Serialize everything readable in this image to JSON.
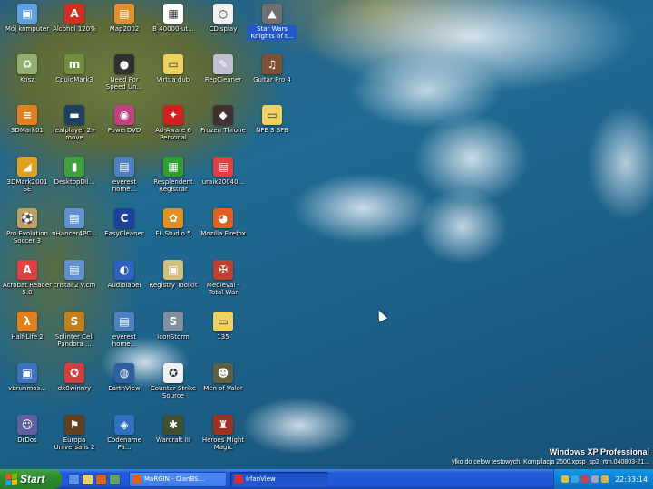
{
  "icons": [
    {
      "name": "moj-komputer",
      "label": "Mój komputer",
      "col": 0,
      "row": 0,
      "color": "#5fa0e0",
      "glyph": "▣"
    },
    {
      "name": "alcohol-120",
      "label": "Alcohol 120%",
      "col": 1,
      "row": 0,
      "color": "#d03020",
      "glyph": "A"
    },
    {
      "name": "map2002",
      "label": "Map2002",
      "col": 2,
      "row": 0,
      "color": "#e09030",
      "glyph": "▤"
    },
    {
      "name": "b-40000",
      "label": "B 40000-ut...",
      "col": 3,
      "row": 0,
      "color": "#ffffff",
      "glyph": "▦"
    },
    {
      "name": "cdisplay",
      "label": "CDisplay",
      "col": 4,
      "row": 0,
      "color": "#f0f0f0",
      "glyph": "○"
    },
    {
      "name": "star-wars",
      "label": "Star Wars Knights of t...",
      "col": 5,
      "row": 0,
      "color": "#707070",
      "glyph": "▲",
      "sel": true
    },
    {
      "name": "kosz",
      "label": "Kosz",
      "col": 0,
      "row": 1,
      "color": "#8fb06f",
      "glyph": "♻"
    },
    {
      "name": "cpuid-mark",
      "label": "CpuidMark3",
      "col": 1,
      "row": 1,
      "color": "#6f8f3f",
      "glyph": "m"
    },
    {
      "name": "need-for-speed",
      "label": "Need For Speed Un...",
      "col": 2,
      "row": 1,
      "color": "#303030",
      "glyph": "●"
    },
    {
      "name": "virtua-dub",
      "label": "Virtua dub",
      "col": 3,
      "row": 1,
      "color": "#f0d060",
      "glyph": "▭"
    },
    {
      "name": "regcleaner",
      "label": "RegCleaner",
      "col": 4,
      "row": 1,
      "color": "#c0c0d0",
      "glyph": "✎"
    },
    {
      "name": "guitar-pro",
      "label": "Guitar Pro 4",
      "col": 5,
      "row": 1,
      "color": "#805030",
      "glyph": "♫"
    },
    {
      "name": "3dmark01",
      "label": "3DMark01",
      "col": 0,
      "row": 2,
      "color": "#e08020",
      "glyph": "≡"
    },
    {
      "name": "realplayer",
      "label": "realplayer 2+ move",
      "col": 1,
      "row": 2,
      "color": "#204060",
      "glyph": "▬"
    },
    {
      "name": "powerdvd",
      "label": "PowerDVD",
      "col": 2,
      "row": 2,
      "color": "#c04080",
      "glyph": "◉"
    },
    {
      "name": "ad-aware",
      "label": "Ad-Aware 6 Personal",
      "col": 3,
      "row": 2,
      "color": "#d02020",
      "glyph": "✦"
    },
    {
      "name": "frozen-throne",
      "label": "Frozen Throne",
      "col": 4,
      "row": 2,
      "color": "#403030",
      "glyph": "◆"
    },
    {
      "name": "nfe-sfb",
      "label": "NFE 3 SFB",
      "col": 5,
      "row": 2,
      "color": "#f0d060",
      "glyph": "▭"
    },
    {
      "name": "3dmark2001",
      "label": "3DMark2001 SE",
      "col": 0,
      "row": 3,
      "color": "#e0a020",
      "glyph": "◢"
    },
    {
      "name": "desktop-dll",
      "label": "DesktopDll...",
      "col": 1,
      "row": 3,
      "color": "#40a040",
      "glyph": "▮"
    },
    {
      "name": "everest-home-1",
      "label": "everest home...",
      "col": 2,
      "row": 3,
      "color": "#5080c0",
      "glyph": "▤"
    },
    {
      "name": "resplendent-registrar",
      "label": "Resplendent Registrar",
      "col": 3,
      "row": 3,
      "color": "#30a030",
      "glyph": "▦"
    },
    {
      "name": "uraik-pdf",
      "label": "uraik20040...",
      "col": 4,
      "row": 3,
      "color": "#e04040",
      "glyph": "▤"
    },
    {
      "name": "pro-evolution",
      "label": "Pro Evolution Soccer 3",
      "col": 0,
      "row": 4,
      "color": "#c0a060",
      "glyph": "⚽"
    },
    {
      "name": "nhancer",
      "label": "nHancer4PC...",
      "col": 1,
      "row": 4,
      "color": "#6090d0",
      "glyph": "▤"
    },
    {
      "name": "easycleaner",
      "label": "EasyCleaner",
      "col": 2,
      "row": 4,
      "color": "#2040a0",
      "glyph": "C"
    },
    {
      "name": "fl-studio",
      "label": "FL Studio 5",
      "col": 3,
      "row": 4,
      "color": "#e09020",
      "glyph": "✿"
    },
    {
      "name": "mozilla-firefox",
      "label": "Mozilla Firefox",
      "col": 4,
      "row": 4,
      "color": "#e06020",
      "glyph": "◕"
    },
    {
      "name": "acrobat-reader",
      "label": "Acrobat Reader 5.0",
      "col": 0,
      "row": 5,
      "color": "#e04040",
      "glyph": "A"
    },
    {
      "name": "cristal-2",
      "label": "cristal 2 v.cm",
      "col": 1,
      "row": 5,
      "color": "#6090d0",
      "glyph": "▤"
    },
    {
      "name": "audiolabel",
      "label": "Audiolabel",
      "col": 2,
      "row": 5,
      "color": "#3060c0",
      "glyph": "◐"
    },
    {
      "name": "registry-toolkit",
      "label": "Registry Toolkit",
      "col": 3,
      "row": 5,
      "color": "#d0c080",
      "glyph": "▣"
    },
    {
      "name": "medieval",
      "label": "Medieval - Total War",
      "col": 4,
      "row": 5,
      "color": "#c04030",
      "glyph": "✠"
    },
    {
      "name": "half-life-2",
      "label": "Half-Life 2",
      "col": 0,
      "row": 6,
      "color": "#e08020",
      "glyph": "λ"
    },
    {
      "name": "splinter-cell",
      "label": "Splinter Cell Pandora ...",
      "col": 1,
      "row": 6,
      "color": "#c08020",
      "glyph": "S"
    },
    {
      "name": "everest-home-2",
      "label": "everest home...",
      "col": 2,
      "row": 6,
      "color": "#5080c0",
      "glyph": "▤"
    },
    {
      "name": "iconstorm",
      "label": "IconStorm",
      "col": 3,
      "row": 6,
      "color": "#8090a0",
      "glyph": "S"
    },
    {
      "name": "folder-135",
      "label": "135",
      "col": 4,
      "row": 6,
      "color": "#f0d060",
      "glyph": "▭"
    },
    {
      "name": "vbrunmos",
      "label": "vbrunmos...",
      "col": 0,
      "row": 7,
      "color": "#4070c0",
      "glyph": "▣"
    },
    {
      "name": "dx8-win",
      "label": "dx8winnry",
      "col": 1,
      "row": 7,
      "color": "#d04040",
      "glyph": "✪"
    },
    {
      "name": "earthview",
      "label": "EarthView",
      "col": 2,
      "row": 7,
      "color": "#3060a0",
      "glyph": "◍"
    },
    {
      "name": "counter-strike",
      "label": "Counter Strike Source",
      "col": 3,
      "row": 7,
      "color": "#f0f0f0",
      "glyph": "✪"
    },
    {
      "name": "men-of-valor",
      "label": "Men of Valor",
      "col": 4,
      "row": 7,
      "color": "#606040",
      "glyph": "☻"
    },
    {
      "name": "drdos",
      "label": "DrDos",
      "col": 0,
      "row": 8,
      "color": "#6060a0",
      "glyph": "☺"
    },
    {
      "name": "europa-universalis",
      "label": "Europa Universalis 2",
      "col": 1,
      "row": 8,
      "color": "#604020",
      "glyph": "⚑"
    },
    {
      "name": "codename-panzers",
      "label": "Codename Pa...",
      "col": 2,
      "row": 8,
      "color": "#3070c0",
      "glyph": "◈"
    },
    {
      "name": "warcraft-iii",
      "label": "Warcraft III",
      "col": 3,
      "row": 8,
      "color": "#405030",
      "glyph": "✱"
    },
    {
      "name": "heroes-might",
      "label": "Heroes Might Magic",
      "col": 4,
      "row": 8,
      "color": "#a03020",
      "glyph": "♜"
    }
  ],
  "watermark": {
    "line1": "Windows XP Professional",
    "line2": "ylko do celow testowych. Kompilacja 2600.xpsp_sp2_rtm.040803-21..."
  },
  "taskbar": {
    "start_label": "Start",
    "quick_launch": [
      {
        "name": "show-desktop-icon",
        "color": "#5c8fe8"
      },
      {
        "name": "explorer-icon",
        "color": "#e8d070"
      },
      {
        "name": "firefox-ql-icon",
        "color": "#e06020"
      },
      {
        "name": "media-ql-icon",
        "color": "#60a060"
      }
    ],
    "tasks": [
      {
        "name": "task-mozilla-firefox",
        "label": "MaRGIN - ClanBS...",
        "color": "#e06020",
        "active": false
      },
      {
        "name": "task-irfanview",
        "label": "IrfanView",
        "color": "#d03030",
        "active": true
      }
    ],
    "tray_icons": [
      {
        "name": "tray-volume-icon",
        "color": "#e0c030"
      },
      {
        "name": "tray-network-icon",
        "color": "#40a0e0"
      },
      {
        "name": "tray-antivirus-icon",
        "color": "#d04040"
      },
      {
        "name": "tray-display-icon",
        "color": "#a0a0c0"
      },
      {
        "name": "tray-update-icon",
        "color": "#e0b040"
      }
    ],
    "clock": "22:33:14"
  }
}
